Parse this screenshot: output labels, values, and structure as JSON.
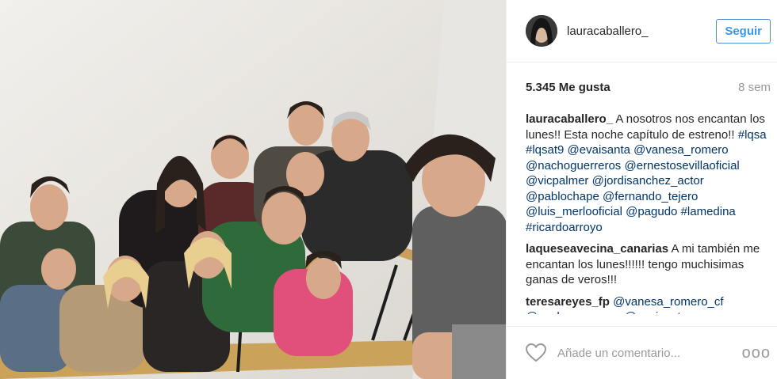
{
  "post": {
    "username": "lauracaballero_",
    "follow_label": "Seguir",
    "likes": "5.345 Me gusta",
    "time_ago": "8 sem"
  },
  "comments": [
    {
      "user": "lauracaballero_",
      "text": "A nosotros nos encantan los lunes!! Esta noche capítulo de estreno!! #lqsa #lqsat9 @evaisanta @vanesa_romero @nachoguerreros @ernestosevillaoficial @vicpalmer @jordisanchez_actor @pablochape @fernando_tejero @luis_merlooficial @pagudo #lamedina #ricardoarroyo"
    },
    {
      "user": "laqueseavecina_canarias",
      "text": "A mi también me encantan los lunes!!!!!! tengo muchisimas ganas de veros!!!"
    },
    {
      "user": "teresareyes_fp",
      "text": "@vanesa_romero_cf @nachoguerreros @evaisanta"
    }
  ],
  "footer": {
    "comment_placeholder": "Añade un comentario...",
    "more_label": "ooo",
    "heart_icon": "heart-outline-icon",
    "more_icon": "more-options-icon"
  },
  "colors": {
    "link": "#003569",
    "follow_text": "#3897f0",
    "muted": "#999999",
    "border": "#efefef"
  }
}
